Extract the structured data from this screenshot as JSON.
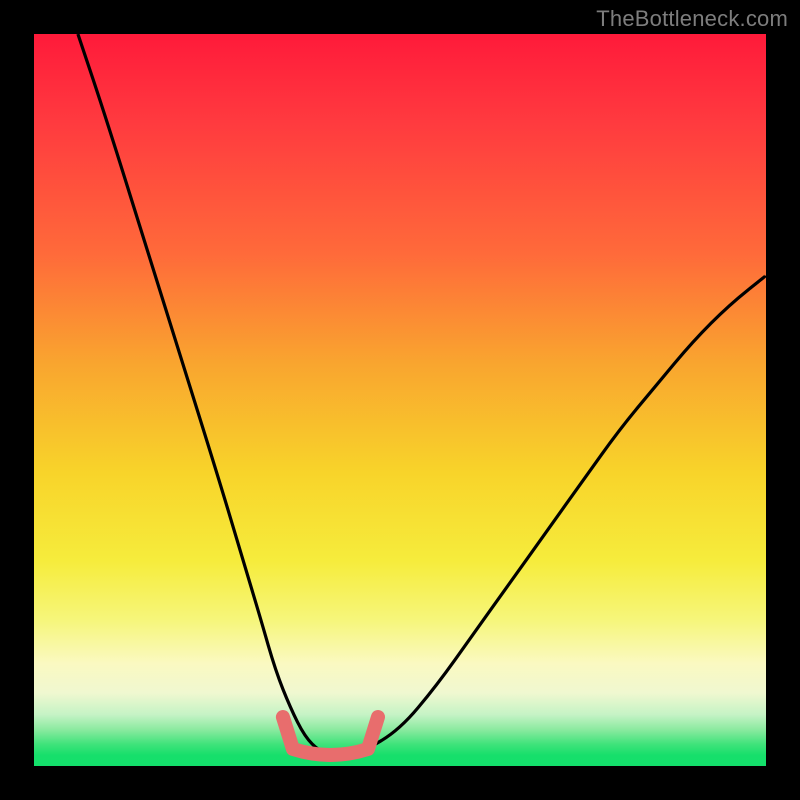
{
  "watermark": "TheBottleneck.com",
  "colors": {
    "page_bg": "#000000",
    "curve_stroke": "#000000",
    "bottom_highlight": "#e86d6d",
    "gradient_top": "#ff1a3a",
    "gradient_mid": "#f8d42a",
    "gradient_bottom": "#13e06b"
  },
  "chart_data": {
    "type": "line",
    "title": "",
    "xlabel": "",
    "ylabel": "",
    "xlim": [
      0,
      100
    ],
    "ylim": [
      0,
      100
    ],
    "series": [
      {
        "name": "bottleneck-curve",
        "x": [
          6,
          10,
          15,
          20,
          25,
          28,
          31,
          33,
          35,
          37,
          39,
          41,
          43,
          45,
          50,
          55,
          60,
          65,
          70,
          75,
          80,
          85,
          90,
          95,
          100
        ],
        "values": [
          100,
          88,
          72,
          56,
          40,
          30,
          20,
          13,
          8,
          4,
          2,
          1.5,
          1.5,
          2,
          5,
          11,
          18,
          25,
          32,
          39,
          46,
          52,
          58,
          63,
          67
        ]
      }
    ],
    "bottom_marker": {
      "x_range": [
        34,
        47
      ],
      "y_value": 1.5
    }
  }
}
